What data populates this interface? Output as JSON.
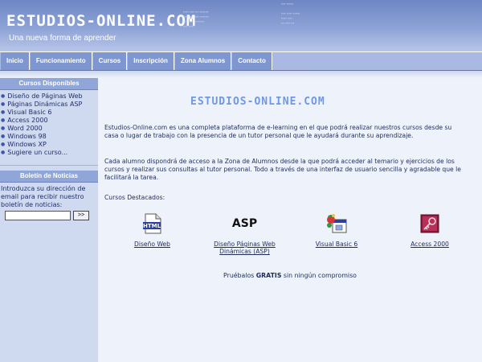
{
  "header": {
    "logo": "ESTUDIOS-ONLINE.COM",
    "tagline": "Una nueva forma de aprender"
  },
  "nav": {
    "items": [
      "Inicio",
      "Funcionamiento",
      "Cursos",
      "Inscripción",
      "Zona Alumnos",
      "Contacto"
    ]
  },
  "sidebar": {
    "courses_title": "Cursos Disponibles",
    "courses": [
      "Diseño de Páginas Web",
      "Páginas Dinámicas ASP",
      "Visual Basic 6",
      "Access 2000",
      "Word 2000",
      "Windows 98",
      "Windows XP",
      "Sugiere un curso..."
    ],
    "newsletter_title": "Boletín de Noticias",
    "newsletter_text": "Introduzca su dirección de email para recibir nuestro boletín de noticias:",
    "newsletter_button": ">>"
  },
  "main": {
    "logo": "ESTUDIOS-ONLINE.COM",
    "intro": "Estudios-Online.com es una completa plataforma de e-learning en el que podrá realizar nuestros cursos desde su casa o lugar de trabajo con la presencia de un tutor personal que le ayudará durante su aprendizaje.",
    "second": "Cada alumno dispondrá de acceso a la Zona de Alumnos desde la que podrá acceder al temario y ejercicios de los cursos y realizar sus consultas al tutor personal. Todo a través de una interfaz de usuario sencilla y agradable que le facilitará la tarea.",
    "featured_label": "Cursos Destacados:",
    "featured": [
      {
        "label": "Diseño Web",
        "icon": "html-icon"
      },
      {
        "label": "Diseño Páginas Web Dinámicas (ASP)",
        "icon": "asp-icon",
        "icon_text": "ASP"
      },
      {
        "label": "Visual Basic 6",
        "icon": "visual-basic-icon"
      },
      {
        "label": "Access 2000",
        "icon": "access-icon"
      }
    ],
    "promo_before": "Pruébalos ",
    "promo_bold": "GRATIS",
    "promo_after": " sin ningún compromiso"
  },
  "colors": {
    "header": "#7f97d0",
    "sidebar": "#cfd9f0",
    "main_bg": "#eef3fb",
    "text": "#1c2b5a",
    "accent_logo": "#6f97e6"
  }
}
